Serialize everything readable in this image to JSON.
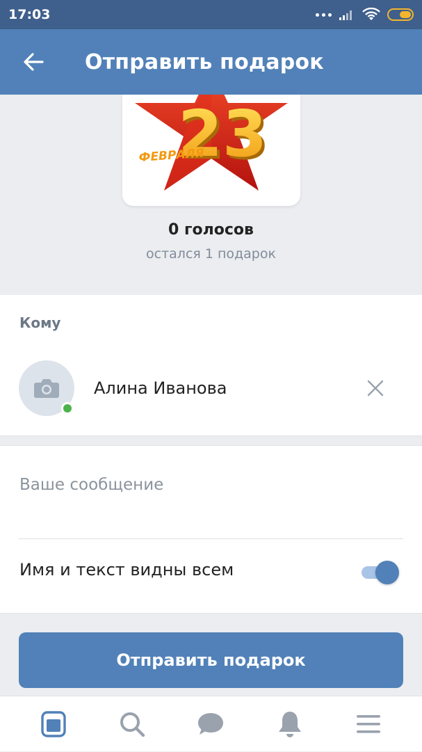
{
  "status_bar": {
    "time": "17:03",
    "icons": [
      "dots-icon",
      "signal-icon",
      "wifi-icon",
      "battery-icon"
    ]
  },
  "app_bar": {
    "back_icon": "arrow-left-icon",
    "title": "Отправить подарок"
  },
  "gift": {
    "image_text": "23 ФЕВРАЛЯ",
    "votes": "0 голосов",
    "remaining": "остался 1 подарок"
  },
  "recipient": {
    "section_label": "Кому",
    "name": "Алина Иванова",
    "avatar_icon": "camera-icon",
    "online": true,
    "remove_icon": "close-icon"
  },
  "message": {
    "placeholder": "Ваше сообщение",
    "value": "",
    "visibility_label": "Имя и текст видны всем",
    "visibility_enabled": true
  },
  "send_button": {
    "label": "Отправить подарок"
  },
  "tab_bar": {
    "tabs": [
      {
        "icon": "news-icon",
        "active": true
      },
      {
        "icon": "search-icon",
        "active": false
      },
      {
        "icon": "messages-icon",
        "active": false
      },
      {
        "icon": "notifications-icon",
        "active": false
      },
      {
        "icon": "menu-icon",
        "active": false
      }
    ]
  },
  "colors": {
    "accent": "#5181b8",
    "status_bar": "#3f5f8c",
    "background": "#ebedf0",
    "online": "#4bb34b",
    "icon_inactive": "#99a2ad"
  }
}
